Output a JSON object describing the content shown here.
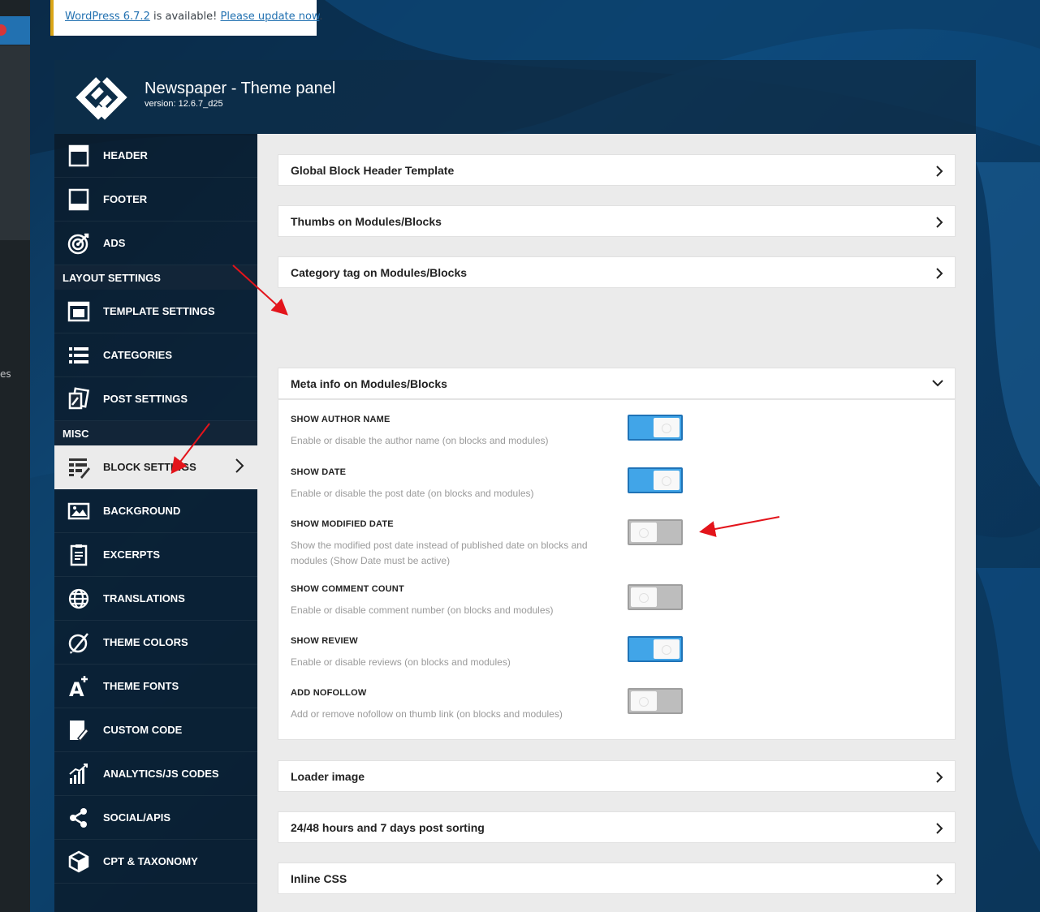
{
  "notice": {
    "version_link": "WordPress 6.7.2",
    "middle": " is available! ",
    "update_link": "Please update now",
    "end": "."
  },
  "wp_sidebar": {
    "partial_text": "es"
  },
  "panel": {
    "title": "Newspaper - Theme panel",
    "version": "version: 12.6.7_d25"
  },
  "sidebar": {
    "items_top": [
      {
        "label": "HEADER",
        "icon": "header-icon"
      },
      {
        "label": "FOOTER",
        "icon": "footer-icon"
      },
      {
        "label": "ADS",
        "icon": "target-icon"
      }
    ],
    "section_layout": "LAYOUT SETTINGS",
    "items_layout": [
      {
        "label": "TEMPLATE SETTINGS",
        "icon": "template-icon"
      },
      {
        "label": "CATEGORIES",
        "icon": "list-icon"
      },
      {
        "label": "POST SETTINGS",
        "icon": "post-settings-icon"
      }
    ],
    "section_misc": "MISC",
    "items_misc": [
      {
        "label": "BLOCK SETTINGS",
        "icon": "block-settings-icon",
        "active": true
      },
      {
        "label": "BACKGROUND",
        "icon": "image-icon"
      },
      {
        "label": "EXCERPTS",
        "icon": "clipboard-icon"
      },
      {
        "label": "TRANSLATIONS",
        "icon": "globe-icon"
      },
      {
        "label": "THEME COLORS",
        "icon": "brush-icon"
      },
      {
        "label": "THEME FONTS",
        "icon": "font-icon"
      },
      {
        "label": "CUSTOM CODE",
        "icon": "code-pen-icon"
      },
      {
        "label": "ANALYTICS/JS CODES",
        "icon": "analytics-icon"
      },
      {
        "label": "SOCIAL/APIS",
        "icon": "share-icon"
      },
      {
        "label": "CPT & TAXONOMY",
        "icon": "cube-icon"
      }
    ]
  },
  "main": {
    "sections": [
      {
        "label": "Global Block Header Template"
      },
      {
        "label": "Thumbs on Modules/Blocks"
      },
      {
        "label": "Category tag on Modules/Blocks"
      },
      {
        "label": "Meta info on Modules/Blocks",
        "open": true
      },
      {
        "label": "Loader image"
      },
      {
        "label": "24/48 hours and 7 days post sorting"
      },
      {
        "label": "Inline CSS"
      }
    ],
    "options": [
      {
        "title": "SHOW AUTHOR NAME",
        "desc": "Enable or disable the author name (on blocks and modules)",
        "state": "on"
      },
      {
        "title": "SHOW DATE",
        "desc": "Enable or disable the post date (on blocks and modules)",
        "state": "on"
      },
      {
        "title": "SHOW MODIFIED DATE",
        "desc": "Show the modified post date instead of published date on blocks and modules (Show Date must be active)",
        "state": "off"
      },
      {
        "title": "SHOW COMMENT COUNT",
        "desc": "Enable or disable comment number (on blocks and modules)",
        "state": "off"
      },
      {
        "title": "SHOW REVIEW",
        "desc": "Enable or disable reviews (on blocks and modules)",
        "state": "on"
      },
      {
        "title": "ADD NOFOLLOW",
        "desc": "Add or remove nofollow on thumb link (on blocks and modules)",
        "state": "off"
      }
    ]
  },
  "colors": {
    "toggle_on": "#41a5e8",
    "toggle_off": "#bdbdbd",
    "annotation": "#e3141b",
    "active_nav_bg": "#ebebeb"
  }
}
